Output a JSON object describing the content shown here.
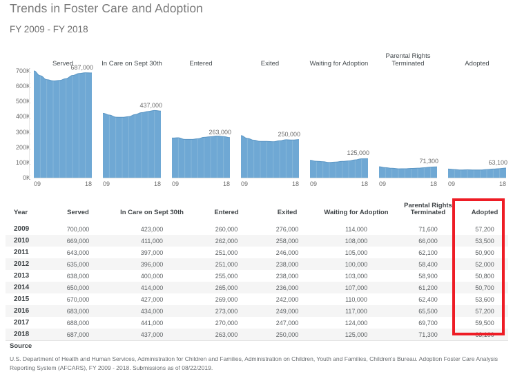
{
  "header": {
    "title": "Trends in Foster Care and Adoption",
    "subtitle": "FY 2009 - FY 2018"
  },
  "chart_data": {
    "type": "area",
    "title": "Trends in Foster Care and Adoption",
    "subtitle": "FY 2009 - FY 2018",
    "xlabel": "",
    "ylabel": "",
    "ylim": [
      0,
      700000
    ],
    "grid": false,
    "y_ticks": [
      "0K",
      "100K",
      "200K",
      "300K",
      "400K",
      "500K",
      "600K",
      "700K"
    ],
    "y_tick_values": [
      0,
      100000,
      200000,
      300000,
      400000,
      500000,
      600000,
      700000
    ],
    "x": [
      2009,
      2010,
      2011,
      2012,
      2013,
      2014,
      2015,
      2016,
      2017,
      2018
    ],
    "x_tick_labels": [
      "09",
      "18"
    ],
    "legend_position": "none",
    "shared_y_axis": true,
    "panels": [
      {
        "title": "Served",
        "values": [
          700000,
          669000,
          643000,
          635000,
          638000,
          650000,
          670000,
          683000,
          688000,
          687000
        ],
        "end_label": "687,000"
      },
      {
        "title": "In Care on Sept 30th",
        "values": [
          423000,
          411000,
          397000,
          396000,
          400000,
          414000,
          427000,
          434000,
          441000,
          437000
        ],
        "end_label": "437,000"
      },
      {
        "title": "Entered",
        "values": [
          260000,
          262000,
          251000,
          251000,
          255000,
          265000,
          269000,
          273000,
          270000,
          263000
        ],
        "end_label": "263,000"
      },
      {
        "title": "Exited",
        "values": [
          276000,
          258000,
          246000,
          238000,
          238000,
          236000,
          242000,
          249000,
          247000,
          250000
        ],
        "end_label": "250,000"
      },
      {
        "title": "Waiting for Adoption",
        "values": [
          114000,
          108000,
          105000,
          100000,
          103000,
          107000,
          110000,
          117000,
          124000,
          125000
        ],
        "end_label": "125,000"
      },
      {
        "title": "Parental Rights\nTerminated",
        "values": [
          71600,
          66000,
          62100,
          58400,
          58900,
          61200,
          62400,
          65500,
          69700,
          71300
        ],
        "end_label": "71,300"
      },
      {
        "title": "Adopted",
        "values": [
          57200,
          53500,
          50900,
          52000,
          50800,
          50700,
          53600,
          57200,
          59500,
          63100
        ],
        "end_label": "63,100"
      }
    ],
    "colors": {
      "area_fill": "#6fa8d4",
      "area_line": "#5b96c4",
      "highlight_box": "#ee1c25"
    }
  },
  "table": {
    "columns": [
      "Year",
      "Served",
      "In Care on Sept 30th",
      "Entered",
      "Exited",
      "Waiting for Adoption",
      "Parental Rights\nTerminated",
      "Adopted"
    ],
    "rows": [
      [
        "2009",
        "700,000",
        "423,000",
        "260,000",
        "276,000",
        "114,000",
        "71,600",
        "57,200"
      ],
      [
        "2010",
        "669,000",
        "411,000",
        "262,000",
        "258,000",
        "108,000",
        "66,000",
        "53,500"
      ],
      [
        "2011",
        "643,000",
        "397,000",
        "251,000",
        "246,000",
        "105,000",
        "62,100",
        "50,900"
      ],
      [
        "2012",
        "635,000",
        "396,000",
        "251,000",
        "238,000",
        "100,000",
        "58,400",
        "52,000"
      ],
      [
        "2013",
        "638,000",
        "400,000",
        "255,000",
        "238,000",
        "103,000",
        "58,900",
        "50,800"
      ],
      [
        "2014",
        "650,000",
        "414,000",
        "265,000",
        "236,000",
        "107,000",
        "61,200",
        "50,700"
      ],
      [
        "2015",
        "670,000",
        "427,000",
        "269,000",
        "242,000",
        "110,000",
        "62,400",
        "53,600"
      ],
      [
        "2016",
        "683,000",
        "434,000",
        "273,000",
        "249,000",
        "117,000",
        "65,500",
        "57,200"
      ],
      [
        "2017",
        "688,000",
        "441,000",
        "270,000",
        "247,000",
        "124,000",
        "69,700",
        "59,500"
      ],
      [
        "2018",
        "687,000",
        "437,000",
        "263,000",
        "250,000",
        "125,000",
        "71,300",
        "63,100"
      ]
    ],
    "highlighted_column": "Adopted"
  },
  "source": {
    "heading": "Source",
    "text": "U.S. Department of Health and Human Services, Administration for Children and Families, Administration on Children, Youth and Families, Children's Bureau. Adoption Foster Care Analysis Reporting System (AFCARS), FY 2009 - 2018. Submissions as of 08/22/2019."
  }
}
